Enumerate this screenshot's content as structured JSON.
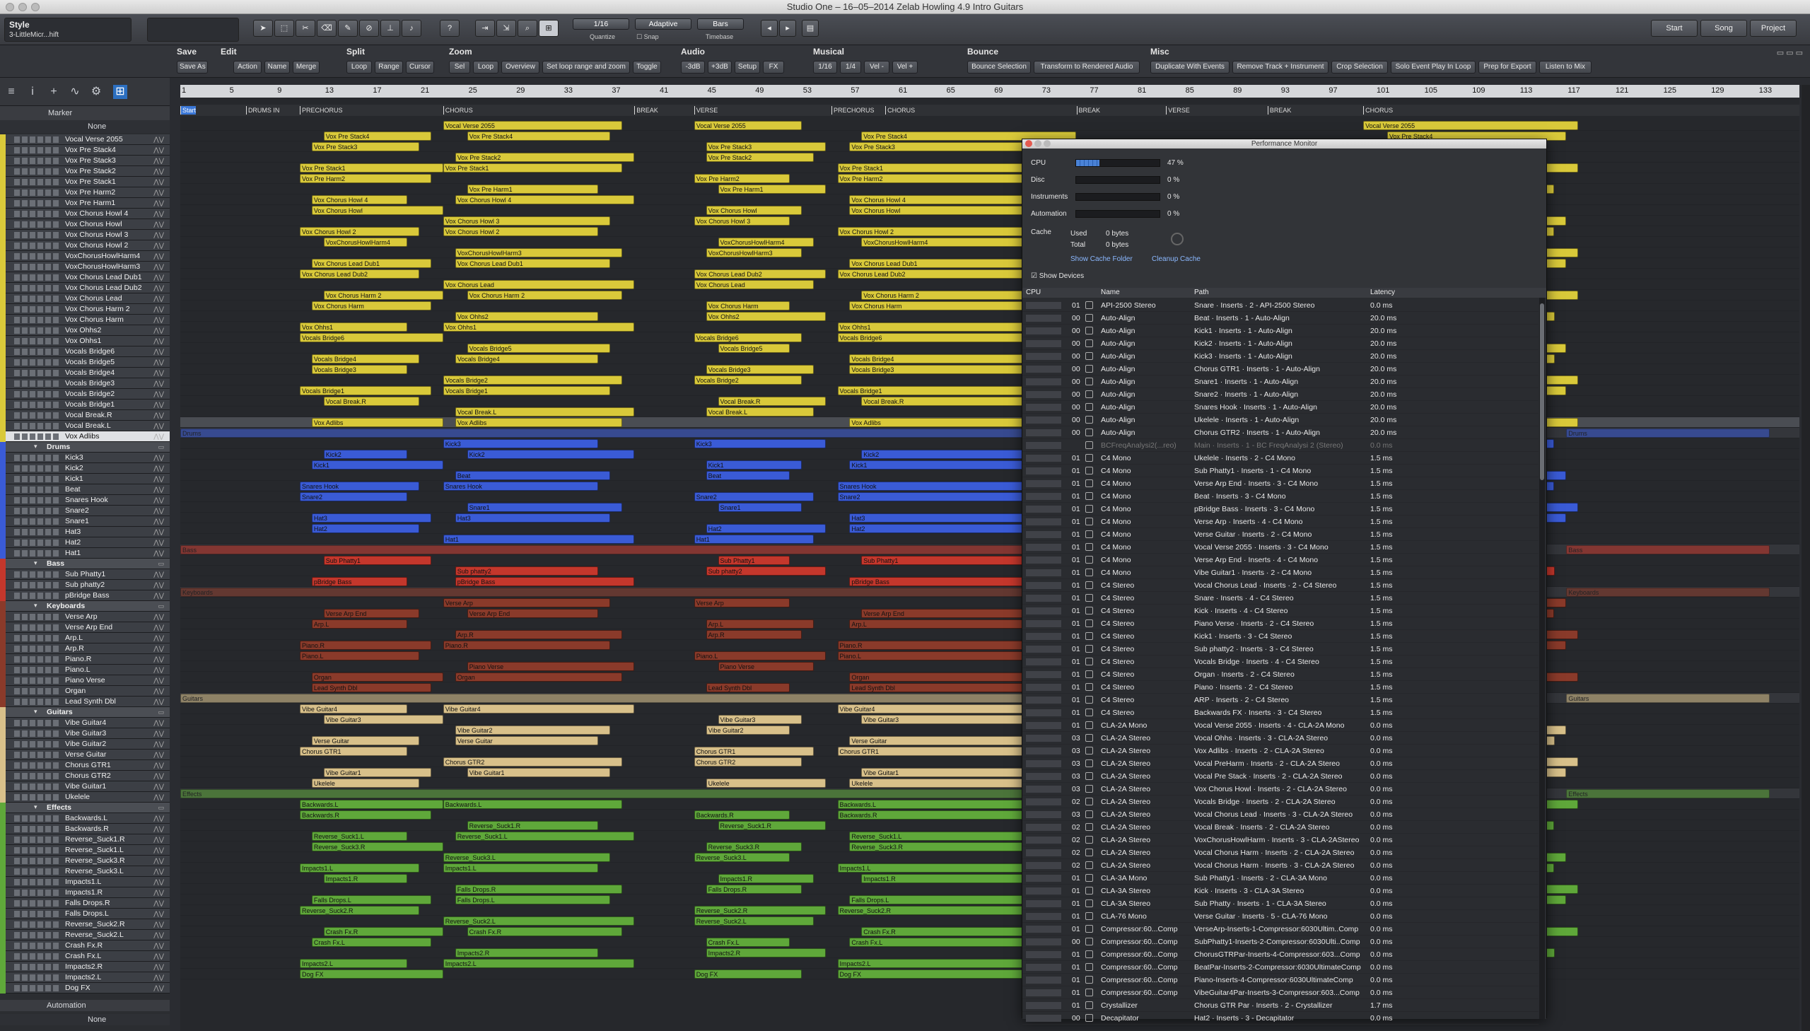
{
  "window": {
    "title": "Studio One – 16–05–2014 Zelab Howling 4.9 Intro Guitars"
  },
  "toolbar": {
    "style_label": "Style",
    "preset": "3-LittleMicr...hift",
    "quantize_value": "1/16",
    "quantize_label": "Quantize",
    "snap_value": "Adaptive",
    "snap_label": "Snap",
    "timebase_value": "Bars",
    "timebase_label": "Timebase",
    "start": "Start",
    "song": "Song",
    "project": "Project"
  },
  "macro": {
    "groups": [
      {
        "title": "Save",
        "buttons": [
          "Save As"
        ]
      },
      {
        "title": "Edit",
        "buttons": [
          "Action",
          "Name",
          "Merge"
        ]
      },
      {
        "title": "Split",
        "buttons": [
          "Loop",
          "Range",
          "Cursor"
        ]
      },
      {
        "title": "Zoom",
        "buttons": [
          "Sel",
          "Loop",
          "Overview",
          "Set loop range and zoom",
          "Toggle"
        ]
      },
      {
        "title": "Audio",
        "buttons": [
          "-3dB",
          "+3dB",
          "Setup",
          "FX"
        ]
      },
      {
        "title": "Musical",
        "buttons": [
          "1/16",
          "1/4",
          "Vel -",
          "Vel +"
        ]
      },
      {
        "title": "Bounce",
        "buttons": [
          "Bounce Selection",
          "Transform to Rendered Audio"
        ]
      },
      {
        "title": "Misc",
        "buttons": [
          "Duplicate With Events",
          "Remove Track + Instrument",
          "Crop Selection",
          "Solo Event Play In Loop",
          "Prep for Export",
          "Listen to Mix"
        ]
      }
    ]
  },
  "left": {
    "marker_label": "Marker",
    "none_label": "None",
    "automation_label": "Automation",
    "automation_none": "None"
  },
  "tracks": [
    {
      "name": "Vocal Verse 2055",
      "color": "#d9c93a"
    },
    {
      "name": "Vox Pre Stack4",
      "color": "#d9c93a"
    },
    {
      "name": "Vox Pre Stack3",
      "color": "#d9c93a"
    },
    {
      "name": "Vox Pre Stack2",
      "color": "#d9c93a"
    },
    {
      "name": "Vox Pre Stack1",
      "color": "#d9c93a"
    },
    {
      "name": "Vox Pre Harm2",
      "color": "#d9c93a"
    },
    {
      "name": "Vox Pre Harm1",
      "color": "#d9c93a"
    },
    {
      "name": "Vox Chorus Howl 4",
      "color": "#d9c93a"
    },
    {
      "name": "Vox Chorus Howl",
      "color": "#d9c93a"
    },
    {
      "name": "Vox Chorus Howl 3",
      "color": "#d9c93a"
    },
    {
      "name": "Vox Chorus Howl 2",
      "color": "#d9c93a"
    },
    {
      "name": "VoxChorusHowlHarm4",
      "color": "#d9c93a"
    },
    {
      "name": "VoxChorusHowlHarm3",
      "color": "#d9c93a"
    },
    {
      "name": "Vox Chorus Lead Dub1",
      "color": "#d9c93a"
    },
    {
      "name": "Vox Chorus Lead Dub2",
      "color": "#d9c93a"
    },
    {
      "name": "Vox Chorus Lead",
      "color": "#d9c93a"
    },
    {
      "name": "Vox Chorus Harm 2",
      "color": "#d9c93a"
    },
    {
      "name": "Vox Chorus Harm",
      "color": "#d9c93a"
    },
    {
      "name": "Vox Ohhs2",
      "color": "#d9c93a"
    },
    {
      "name": "Vox Ohhs1",
      "color": "#d9c93a"
    },
    {
      "name": "Vocals Bridge6",
      "color": "#d9c93a"
    },
    {
      "name": "Vocals Bridge5",
      "color": "#d9c93a"
    },
    {
      "name": "Vocals Bridge4",
      "color": "#d9c93a"
    },
    {
      "name": "Vocals Bridge3",
      "color": "#d9c93a"
    },
    {
      "name": "Vocals Bridge2",
      "color": "#d9c93a"
    },
    {
      "name": "Vocals Bridge1",
      "color": "#d9c93a"
    },
    {
      "name": "Vocal Break.R",
      "color": "#d9c93a"
    },
    {
      "name": "Vocal Break.L",
      "color": "#d9c93a"
    },
    {
      "name": "Vox Adlibs",
      "color": "#d9c93a",
      "selected": true
    },
    {
      "name": "Drums",
      "color": "#3a5bd6",
      "folder": true
    },
    {
      "name": "Kick3",
      "color": "#3a5bd6"
    },
    {
      "name": "Kick2",
      "color": "#3a5bd6"
    },
    {
      "name": "Kick1",
      "color": "#3a5bd6"
    },
    {
      "name": "Beat",
      "color": "#3a5bd6"
    },
    {
      "name": "Snares Hook",
      "color": "#3a5bd6"
    },
    {
      "name": "Snare2",
      "color": "#3a5bd6"
    },
    {
      "name": "Snare1",
      "color": "#3a5bd6"
    },
    {
      "name": "Hat3",
      "color": "#3a5bd6"
    },
    {
      "name": "Hat2",
      "color": "#3a5bd6"
    },
    {
      "name": "Hat1",
      "color": "#3a5bd6"
    },
    {
      "name": "Bass",
      "color": "#c4372c",
      "folder": true
    },
    {
      "name": "Sub Phatty1",
      "color": "#c4372c"
    },
    {
      "name": "Sub phatty2",
      "color": "#c4372c"
    },
    {
      "name": "pBridge Bass",
      "color": "#c4372c"
    },
    {
      "name": "Keyboards",
      "color": "#8a3a2a",
      "folder": true
    },
    {
      "name": "Verse Arp",
      "color": "#8a3a2a"
    },
    {
      "name": "Verse Arp End",
      "color": "#8a3a2a"
    },
    {
      "name": "Arp.L",
      "color": "#8a3a2a"
    },
    {
      "name": "Arp.R",
      "color": "#8a3a2a"
    },
    {
      "name": "Piano.R",
      "color": "#8a3a2a"
    },
    {
      "name": "Piano.L",
      "color": "#8a3a2a"
    },
    {
      "name": "Piano Verse",
      "color": "#8a3a2a"
    },
    {
      "name": "Organ",
      "color": "#8a3a2a"
    },
    {
      "name": "Lead Synth Dbl",
      "color": "#8a3a2a"
    },
    {
      "name": "Guitars",
      "color": "#d8c08a",
      "folder": true
    },
    {
      "name": "Vibe Guitar4",
      "color": "#d8c08a"
    },
    {
      "name": "Vibe Guitar3",
      "color": "#d8c08a"
    },
    {
      "name": "Vibe Guitar2",
      "color": "#d8c08a"
    },
    {
      "name": "Verse Guitar",
      "color": "#d8c08a"
    },
    {
      "name": "Chorus GTR1",
      "color": "#d8c08a"
    },
    {
      "name": "Chorus GTR2",
      "color": "#d8c08a"
    },
    {
      "name": "Vibe Guitar1",
      "color": "#d8c08a"
    },
    {
      "name": "Ukelele",
      "color": "#d8c08a"
    },
    {
      "name": "Effects",
      "color": "#5fa83a",
      "folder": true
    },
    {
      "name": "Backwards.L",
      "color": "#5fa83a"
    },
    {
      "name": "Backwards.R",
      "color": "#5fa83a"
    },
    {
      "name": "Reverse_Suck1.R",
      "color": "#5fa83a"
    },
    {
      "name": "Reverse_Suck1.L",
      "color": "#5fa83a"
    },
    {
      "name": "Reverse_Suck3.R",
      "color": "#5fa83a"
    },
    {
      "name": "Reverse_Suck3.L",
      "color": "#5fa83a"
    },
    {
      "name": "Impacts1.L",
      "color": "#5fa83a"
    },
    {
      "name": "Impacts1.R",
      "color": "#5fa83a"
    },
    {
      "name": "Falls Drops.R",
      "color": "#5fa83a"
    },
    {
      "name": "Falls Drops.L",
      "color": "#5fa83a"
    },
    {
      "name": "Reverse_Suck2.R",
      "color": "#5fa83a"
    },
    {
      "name": "Reverse_Suck2.L",
      "color": "#5fa83a"
    },
    {
      "name": "Crash Fx.R",
      "color": "#5fa83a"
    },
    {
      "name": "Crash Fx.L",
      "color": "#5fa83a"
    },
    {
      "name": "Impacts2.R",
      "color": "#5fa83a"
    },
    {
      "name": "Impacts2.L",
      "color": "#5fa83a"
    },
    {
      "name": "Dog FX",
      "color": "#5fa83a"
    }
  ],
  "ruler": [
    "1",
    "5",
    "9",
    "13",
    "17",
    "21",
    "25",
    "29",
    "33",
    "37",
    "41",
    "45",
    "49",
    "53",
    "57",
    "61",
    "65",
    "69",
    "73",
    "77",
    "81",
    "85",
    "89",
    "93",
    "97",
    "101",
    "105",
    "109",
    "113",
    "117",
    "121",
    "125",
    "129",
    "133"
  ],
  "markers": [
    {
      "label": "Start",
      "bar": 1
    },
    {
      "label": "DRUMS IN",
      "bar": 6.5
    },
    {
      "label": "PRECHORUS",
      "bar": 11
    },
    {
      "label": "CHORUS",
      "bar": 23
    },
    {
      "label": "BREAK",
      "bar": 39
    },
    {
      "label": "VERSE",
      "bar": 44
    },
    {
      "label": "PRECHORUS",
      "bar": 55.5
    },
    {
      "label": "CHORUS",
      "bar": 60
    },
    {
      "label": "BREAK",
      "bar": 76
    },
    {
      "label": "VERSE",
      "bar": 83.5
    },
    {
      "label": "BREAK",
      "bar": 92
    },
    {
      "label": "CHORUS",
      "bar": 100
    }
  ],
  "perf": {
    "title": "Performance Monitor",
    "cpu_label": "CPU",
    "cpu": "47 %",
    "cpu_level": 0.28,
    "disc_label": "Disc",
    "disc": "0 %",
    "inst_label": "Instruments",
    "inst": "0 %",
    "auto_label": "Automation",
    "auto": "0 %",
    "cache_label": "Cache",
    "used_label": "Used",
    "used": "0 bytes",
    "total_label": "Total",
    "total": "0 bytes",
    "show_cache": "Show Cache Folder",
    "cleanup": "Cleanup Cache",
    "show_devices": "Show Devices",
    "col_cpu": "CPU",
    "col_name": "Name",
    "col_path": "Path",
    "col_latency": "Latency",
    "rows": [
      [
        "01",
        "API-2500 Stereo",
        "Snare · Inserts · 2 - API-2500 Stereo",
        "0.0 ms"
      ],
      [
        "00",
        "Auto-Align",
        "Beat · Inserts · 1 - Auto-Align",
        "20.0 ms"
      ],
      [
        "00",
        "Auto-Align",
        "Kick1 · Inserts · 1 - Auto-Align",
        "20.0 ms"
      ],
      [
        "00",
        "Auto-Align",
        "Kick2 · Inserts · 1 - Auto-Align",
        "20.0 ms"
      ],
      [
        "00",
        "Auto-Align",
        "Kick3 · Inserts · 1 - Auto-Align",
        "20.0 ms"
      ],
      [
        "00",
        "Auto-Align",
        "Chorus GTR1 · Inserts · 1 - Auto-Align",
        "20.0 ms"
      ],
      [
        "00",
        "Auto-Align",
        "Snare1 · Inserts · 1 - Auto-Align",
        "20.0 ms"
      ],
      [
        "00",
        "Auto-Align",
        "Snare2 · Inserts · 1 - Auto-Align",
        "20.0 ms"
      ],
      [
        "00",
        "Auto-Align",
        "Snares Hook · Inserts · 1 - Auto-Align",
        "20.0 ms"
      ],
      [
        "00",
        "Auto-Align",
        "Ukelele · Inserts · 1 - Auto-Align",
        "20.0 ms"
      ],
      [
        "00",
        "Auto-Align",
        "Chorus GTR2 · Inserts · 1 - Auto-Align",
        "20.0 ms"
      ],
      [
        "",
        "BCFreqAnalysi2(...reo)",
        "Main · Inserts · 1 - BC FreqAnalysi 2 (Stereo)",
        "0.0 ms"
      ],
      [
        "01",
        "C4 Mono",
        "Ukelele · Inserts · 2 - C4 Mono",
        "1.5 ms"
      ],
      [
        "01",
        "C4 Mono",
        "Sub Phatty1 · Inserts · 1 - C4 Mono",
        "1.5 ms"
      ],
      [
        "01",
        "C4 Mono",
        "Verse Arp End · Inserts · 3 - C4 Mono",
        "1.5 ms"
      ],
      [
        "01",
        "C4 Mono",
        "Beat · Inserts · 3 - C4 Mono",
        "1.5 ms"
      ],
      [
        "01",
        "C4 Mono",
        "pBridge Bass · Inserts · 3 - C4 Mono",
        "1.5 ms"
      ],
      [
        "01",
        "C4 Mono",
        "Verse Arp · Inserts · 4 - C4 Mono",
        "1.5 ms"
      ],
      [
        "01",
        "C4 Mono",
        "Verse Guitar · Inserts · 2 - C4 Mono",
        "1.5 ms"
      ],
      [
        "01",
        "C4 Mono",
        "Vocal Verse 2055 · Inserts · 3 - C4 Mono",
        "1.5 ms"
      ],
      [
        "01",
        "C4 Mono",
        "Verse Arp End · Inserts · 4 - C4 Mono",
        "1.5 ms"
      ],
      [
        "01",
        "C4 Mono",
        "Vibe Guitar1 · Inserts · 2 - C4 Mono",
        "1.5 ms"
      ],
      [
        "01",
        "C4 Stereo",
        "Vocal Chorus Lead · Inserts · 2 - C4 Stereo",
        "1.5 ms"
      ],
      [
        "01",
        "C4 Stereo",
        "Snare · Inserts · 4 - C4 Stereo",
        "1.5 ms"
      ],
      [
        "01",
        "C4 Stereo",
        "Kick · Inserts · 4 - C4 Stereo",
        "1.5 ms"
      ],
      [
        "01",
        "C4 Stereo",
        "Piano Verse · Inserts · 2 - C4 Stereo",
        "1.5 ms"
      ],
      [
        "01",
        "C4 Stereo",
        "Kick1 · Inserts · 3 - C4 Stereo",
        "1.5 ms"
      ],
      [
        "01",
        "C4 Stereo",
        "Sub phatty2 · Inserts · 3 - C4 Stereo",
        "1.5 ms"
      ],
      [
        "01",
        "C4 Stereo",
        "Vocals Bridge · Inserts · 4 - C4 Stereo",
        "1.5 ms"
      ],
      [
        "01",
        "C4 Stereo",
        "Organ · Inserts · 2 - C4 Stereo",
        "1.5 ms"
      ],
      [
        "01",
        "C4 Stereo",
        "Piano · Inserts · 2 - C4 Stereo",
        "1.5 ms"
      ],
      [
        "01",
        "C4 Stereo",
        "ARP · Inserts · 2 - C4 Stereo",
        "1.5 ms"
      ],
      [
        "01",
        "C4 Stereo",
        "Backwards FX · Inserts · 3 - C4 Stereo",
        "1.5 ms"
      ],
      [
        "01",
        "CLA-2A Mono",
        "Vocal Verse 2055 · Inserts · 4 - CLA-2A Mono",
        "0.0 ms"
      ],
      [
        "03",
        "CLA-2A Stereo",
        "Vocal Ohhs · Inserts · 3 - CLA-2A Stereo",
        "0.0 ms"
      ],
      [
        "03",
        "CLA-2A Stereo",
        "Vox Adlibs · Inserts · 2 - CLA-2A Stereo",
        "0.0 ms"
      ],
      [
        "03",
        "CLA-2A Stereo",
        "Vocal PreHarm · Inserts · 2 - CLA-2A Stereo",
        "0.0 ms"
      ],
      [
        "03",
        "CLA-2A Stereo",
        "Vocal Pre Stack · Inserts · 2 - CLA-2A Stereo",
        "0.0 ms"
      ],
      [
        "03",
        "CLA-2A Stereo",
        "Vox Chorus Howl · Inserts · 2 - CLA-2A Stereo",
        "0.0 ms"
      ],
      [
        "02",
        "CLA-2A Stereo",
        "Vocals Bridge · Inserts · 2 - CLA-2A Stereo",
        "0.0 ms"
      ],
      [
        "03",
        "CLA-2A Stereo",
        "Vocal Chorus Lead · Inserts · 3 - CLA-2A Stereo",
        "0.0 ms"
      ],
      [
        "02",
        "CLA-2A Stereo",
        "Vocal Break · Inserts · 2 - CLA-2A Stereo",
        "0.0 ms"
      ],
      [
        "02",
        "CLA-2A Stereo",
        "VoxChorusHowlHarm · Inserts · 3 - CLA-2AStereo",
        "0.0 ms"
      ],
      [
        "02",
        "CLA-2A Stereo",
        "Vocal Chorus Harm · Inserts · 2 - CLA-2A Stereo",
        "0.0 ms"
      ],
      [
        "02",
        "CLA-2A Stereo",
        "Vocal Chorus Harm · Inserts · 3 - CLA-2A Stereo",
        "0.0 ms"
      ],
      [
        "01",
        "CLA-3A Mono",
        "Sub Phatty1 · Inserts · 2 - CLA-3A Mono",
        "0.0 ms"
      ],
      [
        "01",
        "CLA-3A Stereo",
        "Kick · Inserts · 3 - CLA-3A Stereo",
        "0.0 ms"
      ],
      [
        "01",
        "CLA-3A Stereo",
        "Sub Phatty · Inserts · 1 - CLA-3A Stereo",
        "0.0 ms"
      ],
      [
        "01",
        "CLA-76 Mono",
        "Verse Guitar · Inserts · 5 - CLA-76 Mono",
        "0.0 ms"
      ],
      [
        "01",
        "Compressor:60...Comp",
        "VerseArp-Inserts-1-Compressor:6030Ultim..Comp",
        "0.0 ms"
      ],
      [
        "00",
        "Compressor:60...Comp",
        "SubPhatty1-Inserts-2-Compressor:6030Ulti..Comp",
        "0.0 ms"
      ],
      [
        "01",
        "Compressor:60...Comp",
        "ChorusGTRPar-Inserts-4-Compressor:603...Comp",
        "0.0 ms"
      ],
      [
        "01",
        "Compressor:60...Comp",
        "BeatPar-Inserts-2-Compressor:6030UltimateComp",
        "0.0 ms"
      ],
      [
        "01",
        "Compressor:60...Comp",
        "Piano-Inserts-4-Compressor:6030UltimateComp",
        "0.0 ms"
      ],
      [
        "01",
        "Compressor:60...Comp",
        "VibeGuitar4Par-Inserts-3-Compressor:603...Comp",
        "0.0 ms"
      ],
      [
        "01",
        "Crystallizer",
        "Chorus GTR Par · Inserts · 2 - Crystallizer",
        "1.7 ms"
      ],
      [
        "00",
        "Decapitator",
        "Hat2 · Inserts · 3 - Decapitator",
        "0.0 ms"
      ]
    ]
  }
}
